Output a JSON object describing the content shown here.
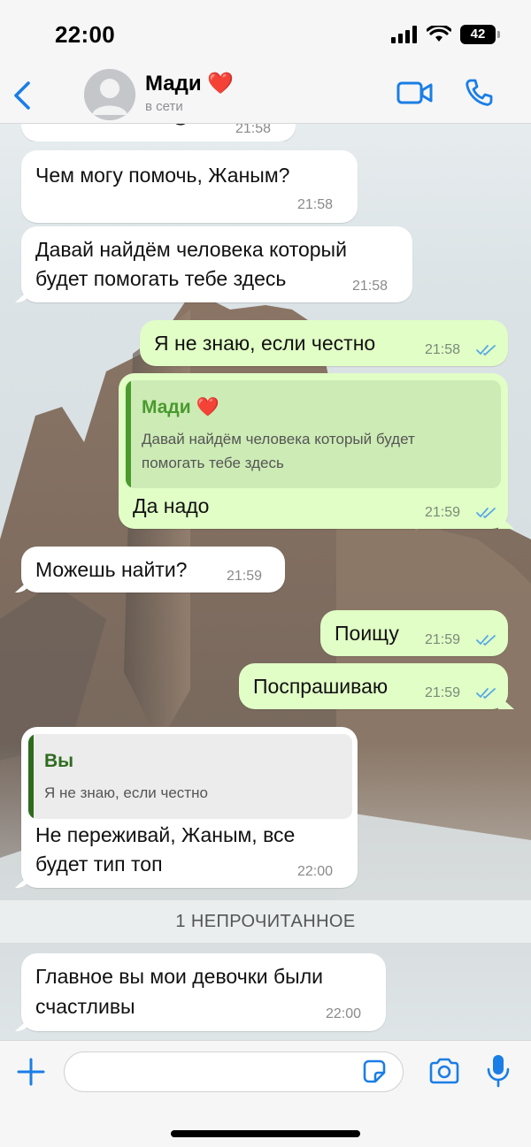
{
  "status": {
    "time": "22:00",
    "battery": "42"
  },
  "header": {
    "contact_name": "Мади ❤️",
    "contact_status": "в сети"
  },
  "messages": [
    {
      "text": "Я так и понял 😞",
      "time": "21:58"
    },
    {
      "text": "Чем могу помочь, Жаным?",
      "time": "21:58"
    },
    {
      "line1": "Давай найдём человека который",
      "line2": "будет помогать тебе здесь",
      "time": "21:58"
    },
    {
      "text": "Я не знаю, если честно",
      "time": "21:58"
    },
    {
      "quote_name": "Мади ❤️",
      "quote_line1": "Давай найдём человека который будет",
      "quote_line2": "помогать тебе здесь",
      "text": "Да надо",
      "time": "21:59"
    },
    {
      "text": "Можешь найти?",
      "time": "21:59"
    },
    {
      "text": "Поищу",
      "time": "21:59"
    },
    {
      "text": "Поспрашиваю",
      "time": "21:59"
    },
    {
      "quote_name": "Вы",
      "quote_line1": "Я не знаю, если честно",
      "line1": "Не переживай, Жаным, все",
      "line2": "будет тип топ",
      "time": "22:00"
    },
    {
      "line1": "Главное вы мои девочки были",
      "line2": "счастливы",
      "time": "22:00"
    }
  ],
  "unread_label": "1 НЕПРОЧИТАННОЕ",
  "input": {
    "placeholder": ""
  },
  "colors": {
    "accent": "#1a7ee6",
    "outgoing": "#e1fec6",
    "incoming": "#ffffff",
    "quote_green": "#4a9a2e",
    "quote_dark_green": "#2e6b1f",
    "check_blue": "#56a7e8"
  },
  "icons": [
    "back-chevron-icon",
    "avatar-placeholder-icon",
    "video-call-icon",
    "phone-icon",
    "double-check-icon",
    "plus-icon",
    "sticker-icon",
    "camera-icon",
    "microphone-icon",
    "signal-icon",
    "wifi-icon",
    "battery-icon"
  ]
}
